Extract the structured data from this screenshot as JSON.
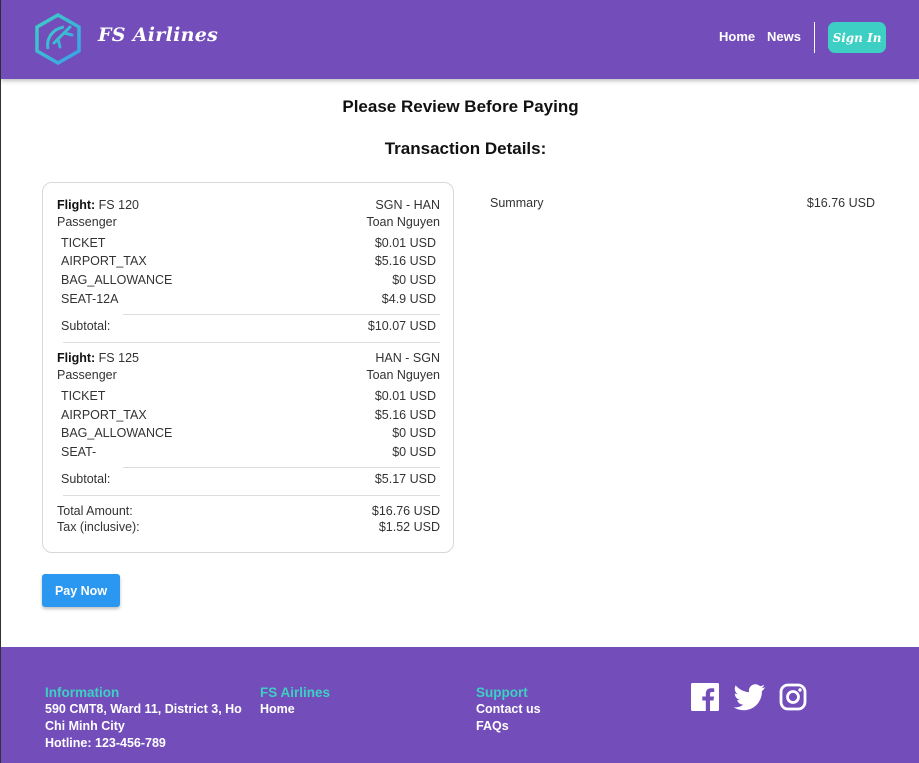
{
  "header": {
    "brand": "FS Airlines",
    "nav": {
      "home": "Home",
      "news": "News"
    },
    "sign_in": "Sign In"
  },
  "page": {
    "title": "Please Review Before Paying",
    "subtitle": "Transaction Details:"
  },
  "flights": [
    {
      "flight_label": "Flight:",
      "flight_no": "FS 120",
      "route": "SGN - HAN",
      "passenger_label": "Passenger",
      "passenger": "Toan Nguyen",
      "items": [
        {
          "name": "TICKET",
          "amount": "$0.01 USD"
        },
        {
          "name": "AIRPORT_TAX",
          "amount": "$5.16 USD"
        },
        {
          "name": "BAG_ALLOWANCE",
          "amount": "$0 USD"
        },
        {
          "name": "SEAT-12A",
          "amount": "$4.9 USD"
        }
      ],
      "subtotal_label": "Subtotal:",
      "subtotal": "$10.07 USD"
    },
    {
      "flight_label": "Flight:",
      "flight_no": "FS 125",
      "route": "HAN - SGN",
      "passenger_label": "Passenger",
      "passenger": "Toan Nguyen",
      "items": [
        {
          "name": "TICKET",
          "amount": "$0.01 USD"
        },
        {
          "name": "AIRPORT_TAX",
          "amount": "$5.16 USD"
        },
        {
          "name": "BAG_ALLOWANCE",
          "amount": "$0 USD"
        },
        {
          "name": "SEAT-",
          "amount": "$0 USD"
        }
      ],
      "subtotal_label": "Subtotal:",
      "subtotal": "$5.17 USD"
    }
  ],
  "totals": {
    "total_label": "Total Amount:",
    "total": "$16.76 USD",
    "tax_label": "Tax (inclusive):",
    "tax": "$1.52 USD"
  },
  "summary": {
    "label": "Summary",
    "amount": "$16.76 USD"
  },
  "pay_button": "Pay Now",
  "footer": {
    "information": {
      "heading": "Information",
      "address_line1": "590 CMT8, Ward 11, District 3, Ho",
      "address_line2": "Chi Minh City",
      "hotline": "Hotline: 123-456-789"
    },
    "brand": {
      "heading": "FS Airlines",
      "home": "Home"
    },
    "support": {
      "heading": "Support",
      "contact": "Contact us",
      "faqs": "FAQs"
    },
    "social_icons": [
      "facebook-icon",
      "twitter-icon",
      "instagram-icon"
    ]
  },
  "colors": {
    "header_bg": "#734ebb",
    "accent_teal": "#3dcfc3",
    "pay_blue": "#2a97f0"
  }
}
